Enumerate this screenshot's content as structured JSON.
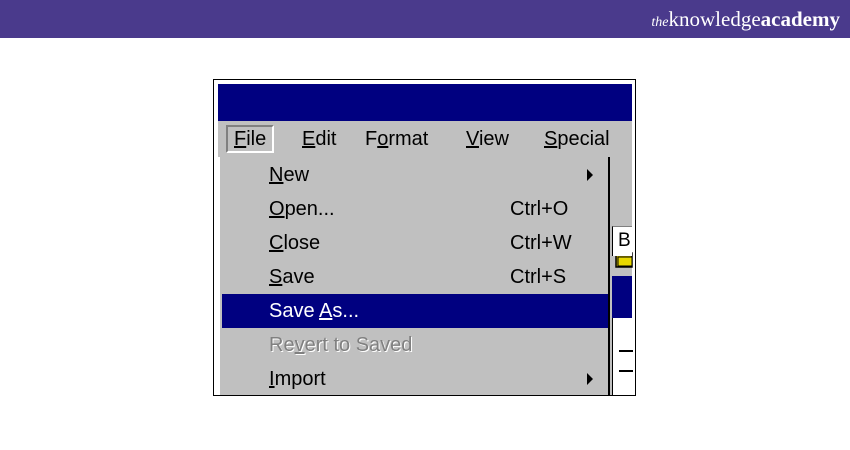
{
  "brand": {
    "prefix": "the",
    "word1": "knowledge",
    "word2": "academy"
  },
  "colors": {
    "banner": "#4a3a8c",
    "titlebar": "#000080",
    "menu_bg": "#c0c0c0",
    "highlight": "#000080"
  },
  "menubar": {
    "items": [
      {
        "mnemonic": "F",
        "rest": "ile",
        "active": true
      },
      {
        "mnemonic": "E",
        "rest": "dit"
      },
      {
        "pre": "F",
        "mnemonic": "o",
        "rest": "rmat"
      },
      {
        "mnemonic": "V",
        "rest": "iew"
      },
      {
        "mnemonic": "S",
        "rest": "pecial"
      }
    ]
  },
  "file_menu": {
    "items": [
      {
        "mnemonic": "N",
        "rest": "ew",
        "shortcut": "",
        "submenu": true
      },
      {
        "mnemonic": "O",
        "rest": "pen...",
        "shortcut": "Ctrl+O"
      },
      {
        "mnemonic": "C",
        "rest": "lose",
        "shortcut": "Ctrl+W"
      },
      {
        "mnemonic": "S",
        "rest": "ave",
        "shortcut": "Ctrl+S"
      },
      {
        "pre": "Save ",
        "mnemonic": "A",
        "rest": "s...",
        "shortcut": "",
        "selected": true
      },
      {
        "pre": "Re",
        "mnemonic": "v",
        "rest": "ert to Saved",
        "shortcut": "",
        "disabled": true
      },
      {
        "mnemonic": "I",
        "rest": "mport",
        "shortcut": "",
        "submenu": true
      }
    ]
  },
  "toolbar": {
    "field_text": "B",
    "icon": "folder-icon"
  }
}
